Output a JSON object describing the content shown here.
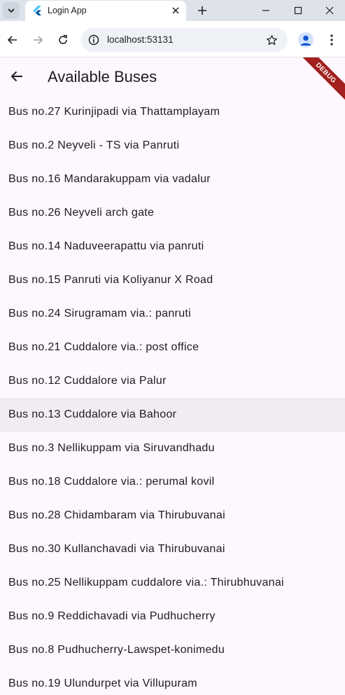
{
  "browser": {
    "tab_title": "Login App",
    "url": "localhost:53131"
  },
  "app": {
    "title": "Available Buses",
    "debug_label": "DEBUG",
    "colors": {
      "background": "#fdf7ff",
      "hover": "#f1ecf4",
      "debug": "#a2201d"
    },
    "buses": [
      {
        "label": "Bus no.27 Kurinjipadi via Thattamplayam"
      },
      {
        "label": "Bus no.2 Neyveli - TS via Panruti"
      },
      {
        "label": "Bus no.16 Mandarakuppam via vadalur"
      },
      {
        "label": "Bus no.26 Neyveli arch gate"
      },
      {
        "label": "Bus no.14 Naduveerapattu via panruti"
      },
      {
        "label": "Bus no.15 Panruti via Koliyanur X Road"
      },
      {
        "label": "Bus no.24 Sirugramam via.: panruti"
      },
      {
        "label": "Bus no.21 Cuddalore via.: post office"
      },
      {
        "label": "Bus no.12 Cuddalore via Palur"
      },
      {
        "label": "Bus no.13 Cuddalore via Bahoor",
        "hovered": true
      },
      {
        "label": "Bus no.3 Nellikuppam via Siruvandhadu"
      },
      {
        "label": "Bus no.18 Cuddalore via.: perumal kovil"
      },
      {
        "label": "Bus no.28 Chidambaram via Thirubuvanai"
      },
      {
        "label": "Bus no.30 Kullanchavadi via Thirubuvanai"
      },
      {
        "label": "Bus no.25 Nellikuppam cuddalore via.: Thirubhuvanai"
      },
      {
        "label": "Bus no.9 Reddichavadi via Pudhucherry"
      },
      {
        "label": "Bus no.8 Pudhucherry-Lawspet-konimedu"
      },
      {
        "label": "Bus no.19 Ulundurpet via Villupuram"
      }
    ]
  }
}
